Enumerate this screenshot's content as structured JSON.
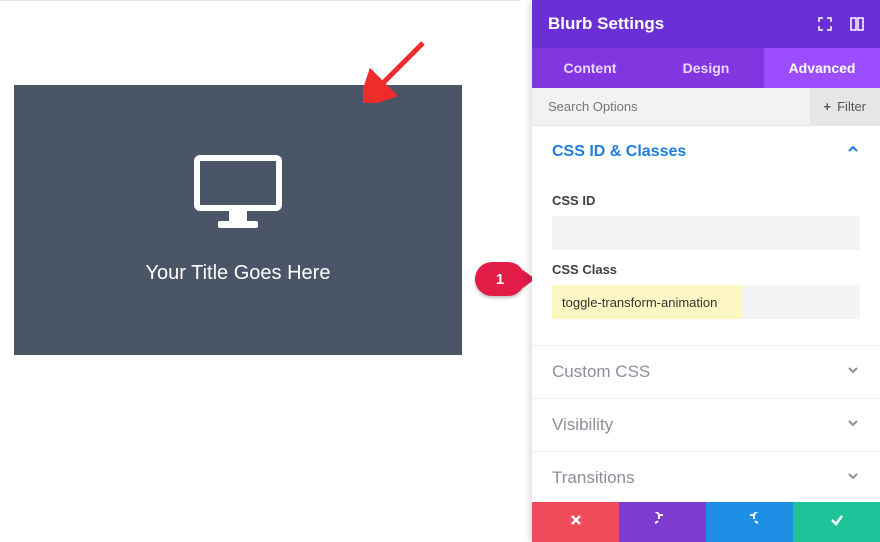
{
  "preview": {
    "title": "Your Title Goes Here",
    "icon": "monitor-icon"
  },
  "annotation": {
    "bubble": "1"
  },
  "panel": {
    "title": "Blurb Settings",
    "tabs": {
      "content": "Content",
      "design": "Design",
      "advanced": "Advanced",
      "active": "advanced"
    },
    "search": {
      "placeholder": "Search Options",
      "filter_label": "Filter"
    },
    "sections": {
      "css_id_classes": {
        "title": "CSS ID & Classes",
        "open": true,
        "fields": {
          "css_id": {
            "label": "CSS ID",
            "value": ""
          },
          "css_class": {
            "label": "CSS Class",
            "value": "toggle-transform-animation"
          }
        }
      },
      "custom_css": {
        "title": "Custom CSS"
      },
      "visibility": {
        "title": "Visibility"
      },
      "transitions": {
        "title": "Transitions"
      }
    },
    "footer": {
      "cancel": "cancel",
      "undo": "undo",
      "redo": "redo",
      "save": "save"
    }
  }
}
